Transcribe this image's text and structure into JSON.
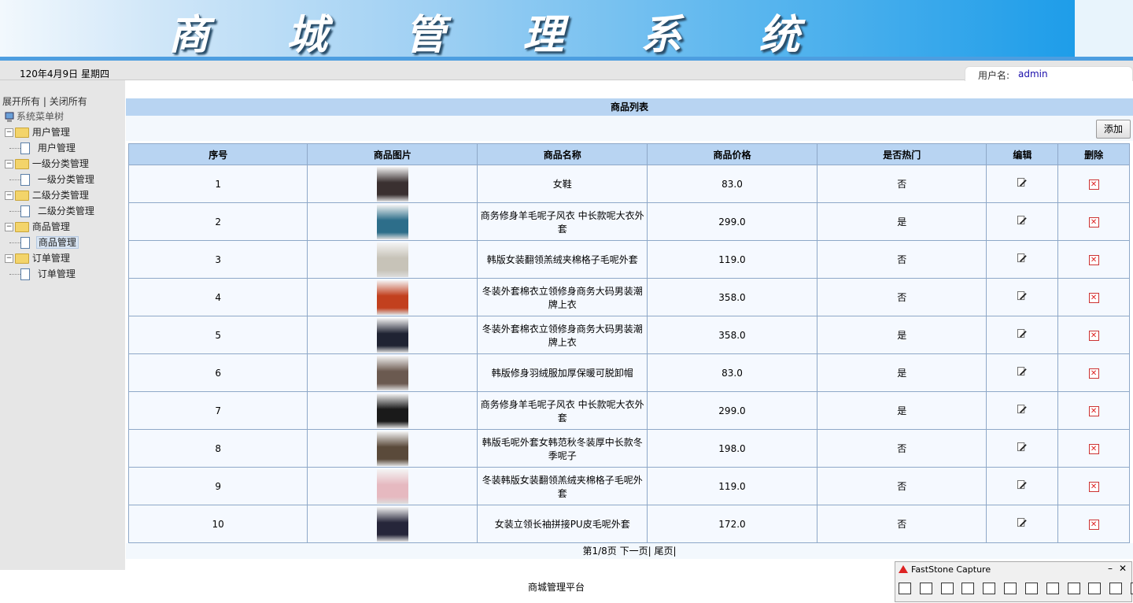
{
  "header": {
    "title": "商 城 管 理 系 统"
  },
  "topbar": {
    "date": "120年4月9日 星期四",
    "user_label": "用户名:",
    "user_name": "admin"
  },
  "sidebar": {
    "expand_all": "展开所有",
    "separator": " | ",
    "collapse_all": "关闭所有",
    "root": "系统菜单树",
    "groups": [
      {
        "label": "用户管理",
        "child": "用户管理"
      },
      {
        "label": "一级分类管理",
        "child": "一级分类管理"
      },
      {
        "label": "二级分类管理",
        "child": "二级分类管理"
      },
      {
        "label": "商品管理",
        "child": "商品管理"
      },
      {
        "label": "订单管理",
        "child": "订单管理"
      }
    ]
  },
  "main": {
    "list_title": "商品列表",
    "add_label": "添加",
    "columns": [
      "序号",
      "商品图片",
      "商品名称",
      "商品价格",
      "是否热门",
      "编辑",
      "删除"
    ],
    "rows": [
      {
        "no": "1",
        "name": "女鞋",
        "price": "83.0",
        "hot": "否",
        "img_color": "#3a3030"
      },
      {
        "no": "2",
        "name": "商务修身羊毛呢子风衣 中长款呢大衣外套",
        "price": "299.0",
        "hot": "是",
        "img_color": "#2d6e8a"
      },
      {
        "no": "3",
        "name": "韩版女装翻领羔绒夹棉格子毛呢外套",
        "price": "119.0",
        "hot": "否",
        "img_color": "#c7c3b8"
      },
      {
        "no": "4",
        "name": "冬装外套棉衣立领修身商务大码男装潮牌上衣",
        "price": "358.0",
        "hot": "否",
        "img_color": "#c2401e"
      },
      {
        "no": "5",
        "name": "冬装外套棉衣立领修身商务大码男装潮牌上衣",
        "price": "358.0",
        "hot": "是",
        "img_color": "#1f2333"
      },
      {
        "no": "6",
        "name": "韩版修身羽绒服加厚保暖可脱卸帽",
        "price": "83.0",
        "hot": "是",
        "img_color": "#6b5a50"
      },
      {
        "no": "7",
        "name": "商务修身羊毛呢子风衣 中长款呢大衣外套",
        "price": "299.0",
        "hot": "是",
        "img_color": "#1a1a1a"
      },
      {
        "no": "8",
        "name": "韩版毛呢外套女韩范秋冬装厚中长款冬季呢子",
        "price": "198.0",
        "hot": "否",
        "img_color": "#5a4a3a"
      },
      {
        "no": "9",
        "name": "冬装韩版女装翻领羔绒夹棉格子毛呢外套",
        "price": "119.0",
        "hot": "否",
        "img_color": "#e6b9c0"
      },
      {
        "no": "10",
        "name": "女装立领长袖拼接PU皮毛呢外套",
        "price": "172.0",
        "hot": "否",
        "img_color": "#26263a"
      }
    ],
    "pagination": {
      "page_info": "第1/8页",
      "next": "下一页|",
      "last": "尾页|"
    }
  },
  "footer": {
    "text": "商城管理平台"
  },
  "faststone": {
    "title": "FastStone Capture",
    "minimize": "–",
    "close": "✕"
  }
}
